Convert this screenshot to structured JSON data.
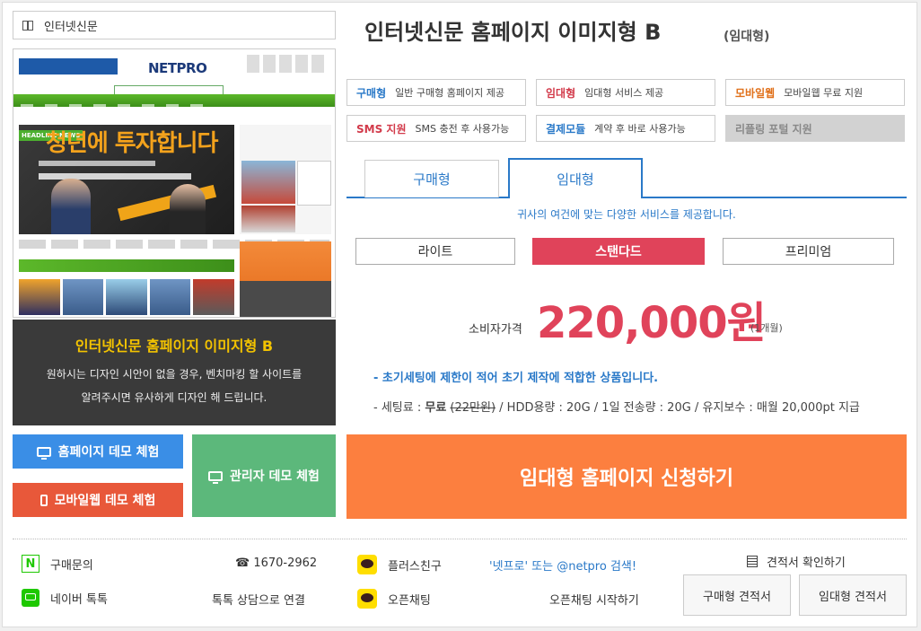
{
  "breadcrumb": {
    "label": "인터넷신문"
  },
  "preview": {
    "logo_pre": "NETPRO",
    "logo_accent": "",
    "hero_tag": "HEADLINE NEWS",
    "hero_title": "청년에 투자합니다"
  },
  "caption": {
    "title": "인터넷신문 홈페이지 이미지형 B",
    "desc1": "원하시는 디자인 시안이 없을 경우, 벤치마킹 할 사이트를",
    "desc2": "알려주시면 유사하게 디자인 해 드립니다."
  },
  "buttons": {
    "homepage_demo": "홈페이지 데모 체험",
    "mobile_demo": "모바일웹 데모 체험",
    "admin_demo": "관리자 데모 체험",
    "apply": "임대형 홈페이지 신청하기"
  },
  "product": {
    "title": "인터넷신문 홈페이지 이미지형 B",
    "type": "(임대형)"
  },
  "features": [
    {
      "name": "구매형",
      "desc": "일반 구매형 홈페이지 제공"
    },
    {
      "name": "임대형",
      "desc": "임대형 서비스 제공"
    },
    {
      "name": "모바일웹",
      "desc": "모바일웹 무료 지원"
    },
    {
      "name": "SMS 지원",
      "desc": "SMS 충전 후 사용가능"
    },
    {
      "name": "결제모듈",
      "desc": "계약 후 바로 사용가능"
    },
    {
      "name": "리플링 포털 지원",
      "desc": ""
    }
  ],
  "tabs": {
    "buy": "구매형",
    "rent": "임대형"
  },
  "tab_desc": "귀사의 여건에 맞는 다양한 서비스를 제공합니다.",
  "plans": {
    "lite": "라이트",
    "standard": "스탠다드",
    "premium": "프리미엄"
  },
  "price": {
    "label": "소비자가격",
    "value": "220,000원",
    "unit": "(1개월)"
  },
  "notes": {
    "line1": "- 초기세팅에 제한이 적어 초기 제작에 적합한 상품입니다.",
    "line2_prefix": "- 세팅료 : ",
    "line2_free": "무료",
    "line2_strike": "(22만원)",
    "line2_rest": " / HDD용량 : 20G / 1일 전송량 : 20G / 유지보수 : 매월 20,000pt 지급"
  },
  "footer": {
    "inquiry": "구매문의",
    "phone": "☎ 1670-2962",
    "naver_talk": "네이버 톡톡",
    "talk_connect": "톡톡 상담으로 연결",
    "plus_friend": "플러스친구",
    "search_hint": "'넷프로' 또는 @netpro 검색!",
    "open_chat": "오픈채팅",
    "open_chat_start": "오픈채팅 시작하기",
    "quote_check": "견적서 확인하기",
    "quote_buy": "구매형 견적서",
    "quote_rent": "임대형 견적서"
  },
  "colors": {
    "accent_blue": "#2a79c8",
    "accent_red": "#e0435a",
    "apply_orange": "#fc7f3f",
    "demo_blue": "#3a8ee6",
    "mobile_red": "#e8583a",
    "admin_green": "#5cb87b"
  }
}
